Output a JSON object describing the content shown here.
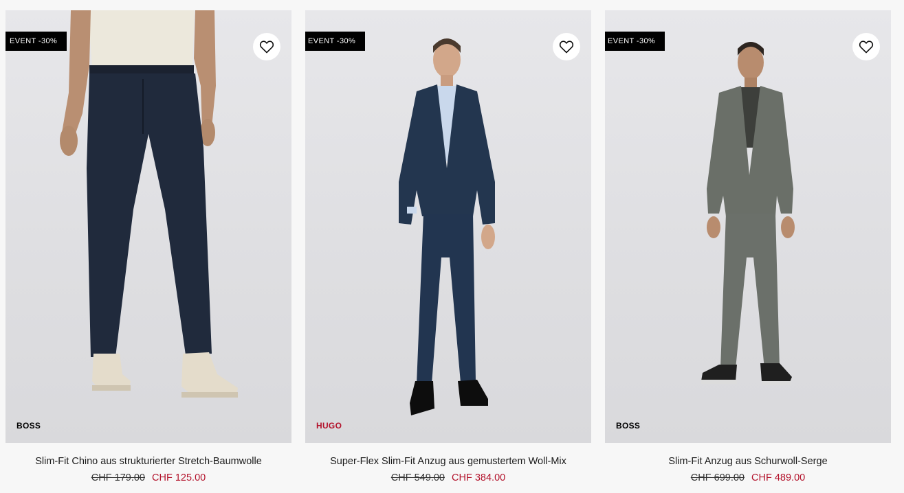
{
  "products": [
    {
      "badge": "EVENT -30%",
      "brand": "BOSS",
      "title": "Slim-Fit Chino aus strukturierter Stretch-Baumwolle",
      "old_price": "CHF 179.00",
      "new_price": "CHF 125.00",
      "image": "navy-chino-trousers-with-white-shoes"
    },
    {
      "badge": "EVENT -30%",
      "brand": "HUGO",
      "title": "Super-Flex Slim-Fit Anzug aus gemustertem Woll-Mix",
      "old_price": "CHF 549.00",
      "new_price": "CHF 384.00",
      "image": "navy-suit-with-light-blue-shirt"
    },
    {
      "badge": "EVENT -30%",
      "brand": "BOSS",
      "title": "Slim-Fit Anzug aus Schurwoll-Serge",
      "old_price": "CHF 699.00",
      "new_price": "CHF 489.00",
      "image": "grey-suit-with-sneakers"
    }
  ],
  "icons": {
    "wishlist": "heart-outline-icon"
  },
  "colors": {
    "sale": "#b3122b",
    "hugo_brand": "#b3122b",
    "badge_bg": "#000000"
  }
}
